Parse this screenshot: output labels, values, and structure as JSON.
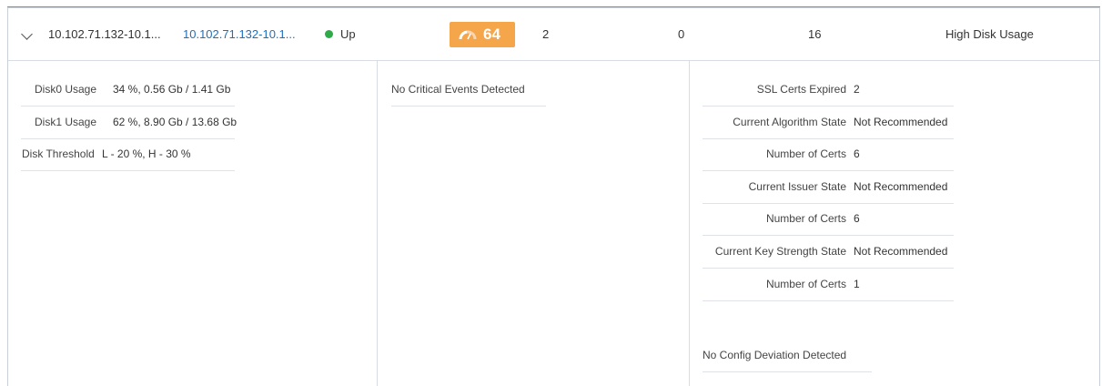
{
  "summary": {
    "name": "10.102.71.132-10.1...",
    "host_link": "10.102.71.132-10.1...",
    "status": "Up",
    "score": "64",
    "col_a": "2",
    "col_b": "0",
    "col_c": "16",
    "issue": "High Disk Usage",
    "colors": {
      "score_badge": "#f5a54a",
      "status_up": "#2eaa4a",
      "link": "#1f6fba"
    }
  },
  "disk": [
    {
      "label": "Disk0 Usage",
      "value": "34 %, 0.56 Gb / 1.41 Gb"
    },
    {
      "label": "Disk1 Usage",
      "value": "62 %, 8.90 Gb / 13.68 Gb"
    },
    {
      "label": "Disk Threshold",
      "value": "L - 20 %, H - 30 %"
    }
  ],
  "events": {
    "message": "No Critical Events Detected"
  },
  "ssl": [
    {
      "label": "SSL Certs Expired",
      "value": "2"
    },
    {
      "label": "Current Algorithm State",
      "value": "Not Recommended"
    },
    {
      "label": "Number of Certs",
      "value": "6"
    },
    {
      "label": "Current Issuer State",
      "value": "Not Recommended"
    },
    {
      "label": "Number of Certs",
      "value": "6"
    },
    {
      "label": "Current Key Strength State",
      "value": "Not Recommended"
    },
    {
      "label": "Number of Certs",
      "value": "1"
    }
  ],
  "config": {
    "message": "No Config Deviation Detected"
  }
}
